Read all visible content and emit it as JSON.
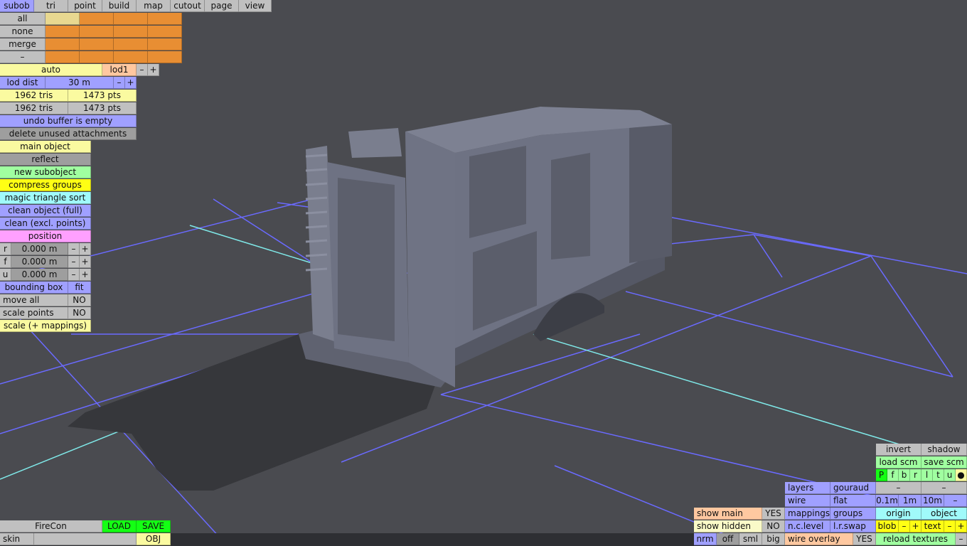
{
  "tabs": [
    "subob",
    "tri",
    "point",
    "build",
    "map",
    "cutout",
    "page",
    "view"
  ],
  "selection": {
    "all": "all",
    "none": "none",
    "merge": "merge",
    "dash": "–"
  },
  "lod": {
    "auto": "auto",
    "lod1": "lod1",
    "minus": "–",
    "plus": "+",
    "dist_label": "lod dist",
    "dist_value": "30 m"
  },
  "stats": [
    {
      "tris": "1962 tris",
      "pts": "1473 pts"
    },
    {
      "tris": "1962 tris",
      "pts": "1473 pts"
    }
  ],
  "undo": "undo buffer is empty",
  "delete_unused": "delete unused attachments",
  "main_object": "main object",
  "reflect": "reflect",
  "new_subobject": "new subobject",
  "compress_groups": "compress groups",
  "magic_sort": "magic triangle sort",
  "clean_full": "clean object (full)",
  "clean_excl": "clean (excl. points)",
  "position": {
    "label": "position",
    "rows": [
      {
        "axis": "r",
        "value": "0.000 m"
      },
      {
        "axis": "f",
        "value": "0.000 m"
      },
      {
        "axis": "u",
        "value": "0.000 m"
      }
    ],
    "minus": "–",
    "plus": "+"
  },
  "bounding_box": {
    "label": "bounding box",
    "fit": "fit"
  },
  "move_all": {
    "label": "move all",
    "value": "NO"
  },
  "scale_points": {
    "label": "scale points",
    "value": "NO"
  },
  "scale_mappings": "scale (+ mappings)",
  "file": {
    "name": "FireCon",
    "load": "LOAD",
    "save": "SAVE",
    "skin": "skin",
    "format": "OBJ"
  },
  "view_opts": {
    "show_main": "show main",
    "show_main_val": "YES",
    "show_hidden": "show hidden",
    "show_hidden_val": "NO",
    "nrm": "nrm",
    "off": "off",
    "sml": "sml",
    "big": "big"
  },
  "render": {
    "layers": "layers",
    "gouraud": "gouraud",
    "wire": "wire",
    "flat": "flat",
    "mappings": "mappings",
    "groups": "groups",
    "nclevel": "n.c.level",
    "lrswap": "l.r.swap",
    "wire_overlay": "wire overlay",
    "wire_overlay_val": "YES"
  },
  "right_panel": {
    "invert": "invert",
    "shadow": "shadow",
    "load_scm": "load scm",
    "save_scm": "save scm",
    "views": [
      "P",
      "f",
      "b",
      "r",
      "l",
      "t",
      "u",
      "●"
    ],
    "dash": "–",
    "grid": [
      "0.1m",
      "1m",
      "10m",
      "–"
    ],
    "origin": "origin",
    "object": "object",
    "blob": "blob",
    "text": "text",
    "minus": "–",
    "plus": "+",
    "reload": "reload textures"
  },
  "colors": {
    "background": "#4a4b50",
    "grid": "#6a6aff",
    "axis": "#7fe8e8",
    "model": "#6e7283",
    "shadow": "#36373b"
  }
}
